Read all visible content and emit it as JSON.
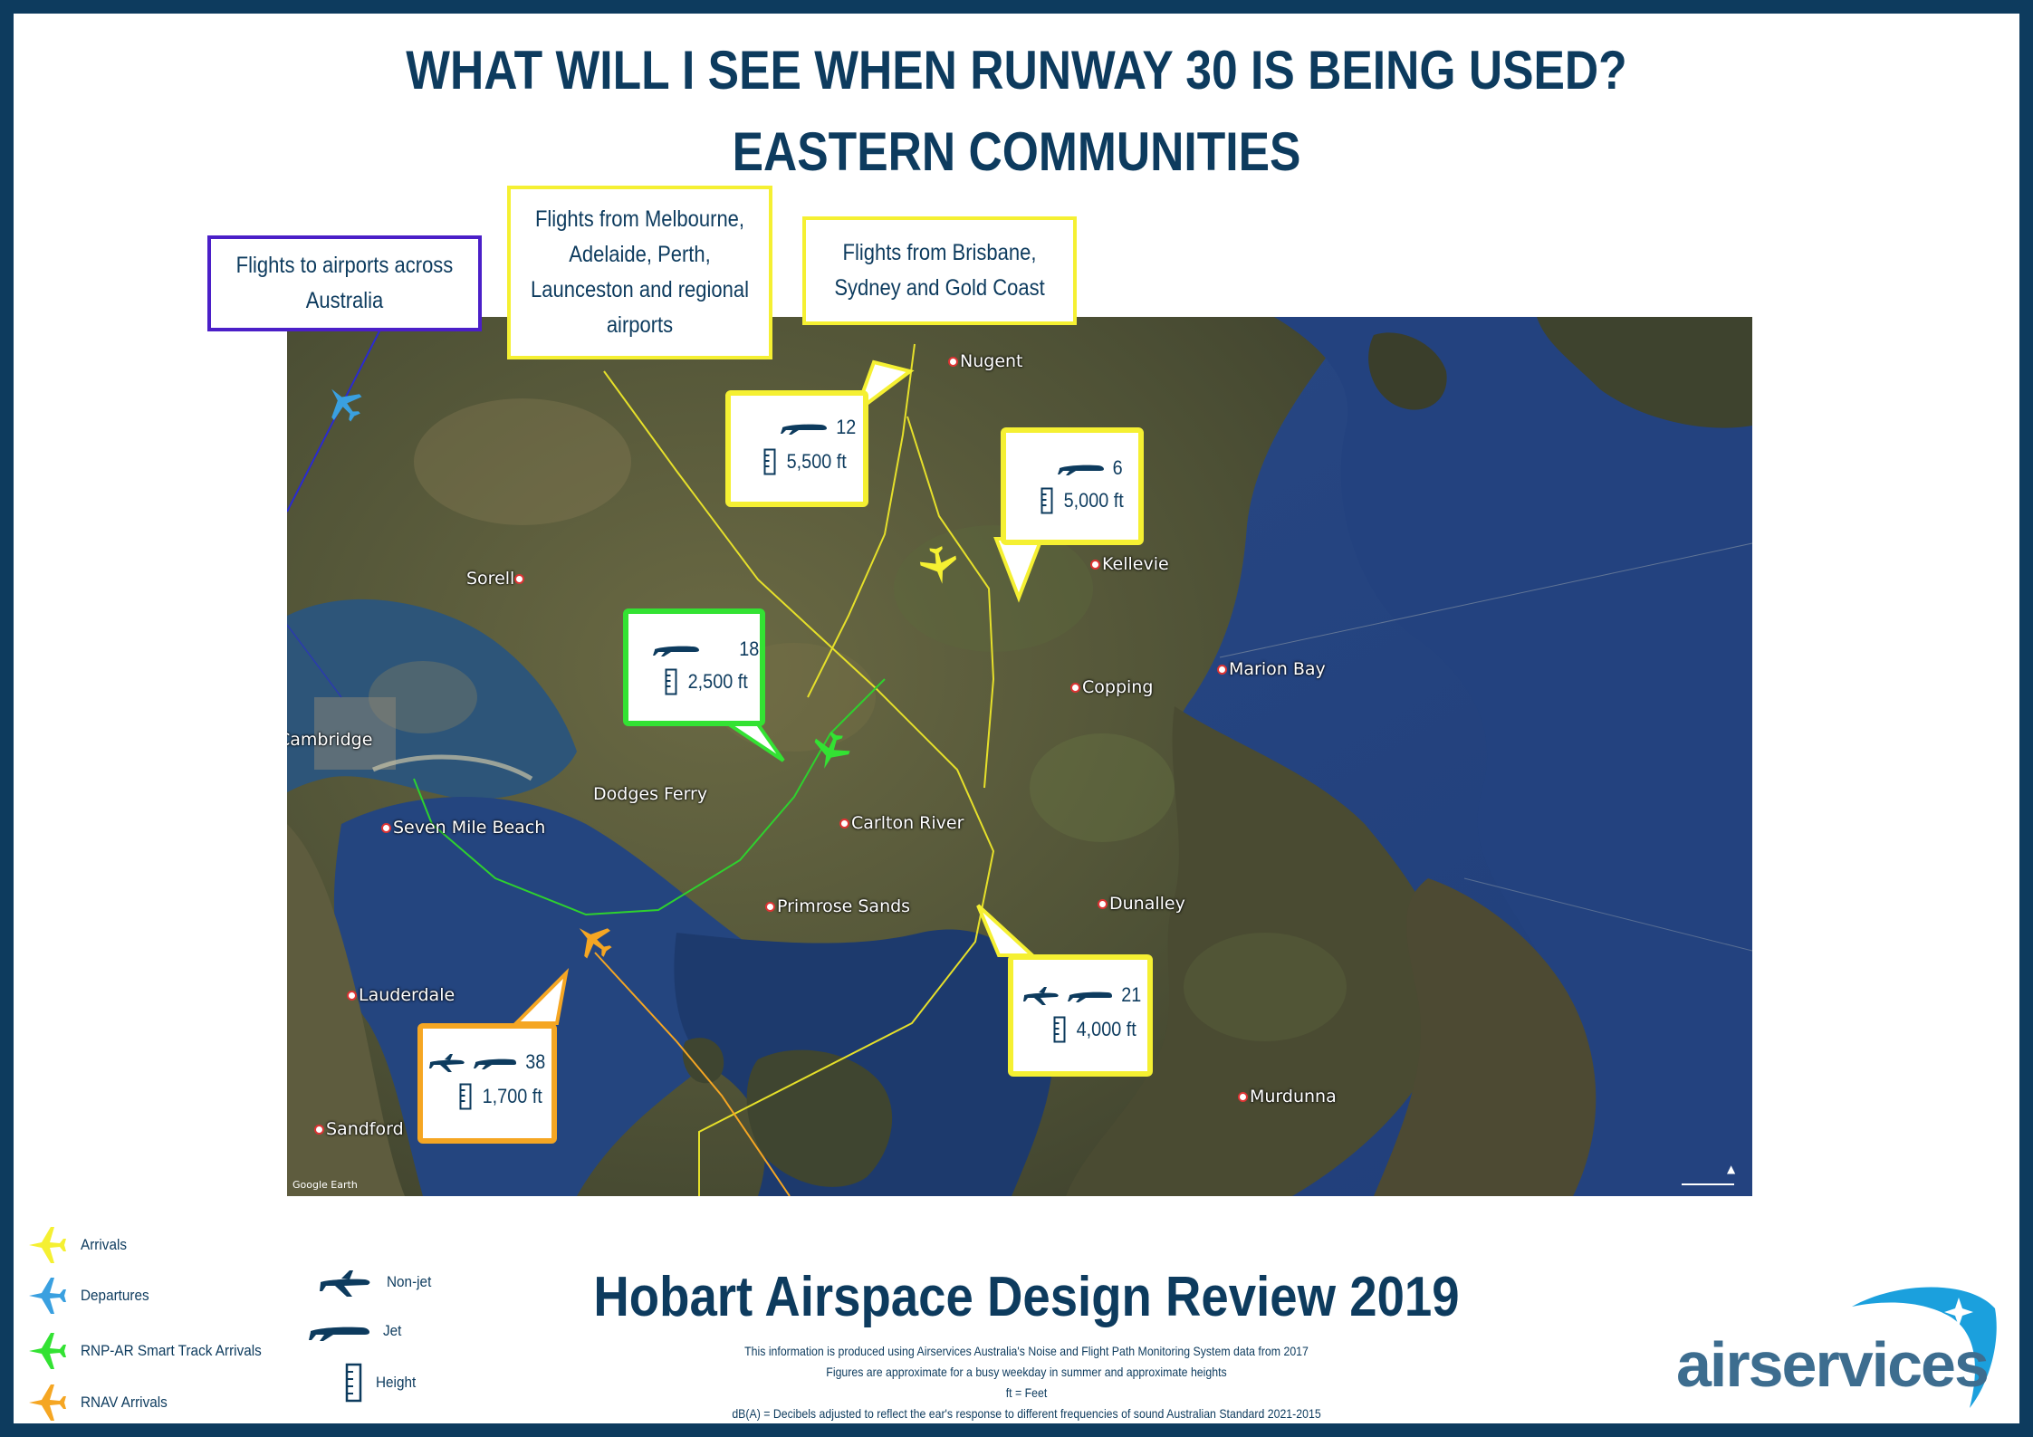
{
  "title_line1": "WHAT WILL I SEE WHEN RUNWAY 30 IS BEING USED?",
  "title_line2": "EASTERN COMMUNITIES",
  "callouts": {
    "departures": "Flights to airports across Australia",
    "west_arrivals": "Flights from Melbourne, Adelaide, Perth, Launceston and regional airports",
    "north_arrivals": "Flights from Brisbane, Sydney and Gold Coast"
  },
  "info_boxes": [
    {
      "flights": "12",
      "height": "5,500 ft",
      "color": "#f5f032"
    },
    {
      "flights": "6",
      "height": "5,000 ft",
      "color": "#f5f032"
    },
    {
      "flights": "18",
      "height": "2,500 ft",
      "color": "#33e233"
    },
    {
      "flights": "21",
      "height": "4,000 ft",
      "color": "#f5f032"
    },
    {
      "flights": "38",
      "height": "1,700 ft",
      "color": "#f5a623"
    }
  ],
  "places": {
    "nugent": "Nugent",
    "sorell": "Sorell",
    "kellevie": "Kellevie",
    "marion_bay": "Marion Bay",
    "copping": "Copping",
    "cambridge": "Cambridge",
    "dodges_ferry": "Dodges Ferry",
    "seven_mile_beach": "Seven Mile Beach",
    "carlton_river": "Carlton River",
    "primrose_sands": "Primrose Sands",
    "dunalley": "Dunalley",
    "lauderdale": "Lauderdale",
    "murdunna": "Murdunna",
    "sandford": "Sandford"
  },
  "legend": {
    "arrivals": "Arrivals",
    "departures": "Departures",
    "rnp": "RNP-AR Smart Track  Arrivals",
    "rnav": "RNAV Arrivals",
    "nonjet": "Non-jet",
    "jet": "Jet",
    "height": "Height"
  },
  "colors": {
    "navy": "#0d3b5e",
    "arrivals": "#f5f032",
    "departures": "#3aa0e0",
    "rnp": "#33e233",
    "rnav": "#f5a623",
    "departure_box": "#4b1fc8"
  },
  "footer": {
    "title": "Hobart Airspace Design Review 2019",
    "line1": "This information is produced using Airservices Australia's Noise and Flight Path Monitoring System data from 2017",
    "line2": "Figures  are approximate for a busy weekday in summer and approximate heights",
    "line3": "ft = Feet",
    "line4": "dB(A) = Decibels adjusted to reflect the ear's response to different frequencies of sound Australian Standard 2021-2015"
  },
  "logo": "airservices",
  "map_credit": "Google Earth"
}
